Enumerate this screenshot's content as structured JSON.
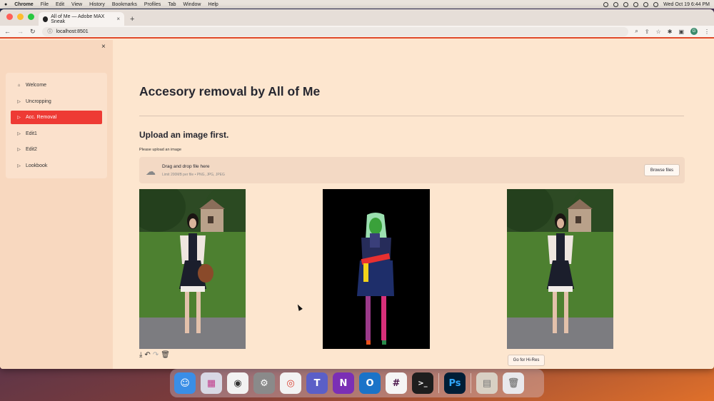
{
  "menubar": {
    "apple": "",
    "app": "Chrome",
    "items": [
      "File",
      "Edit",
      "View",
      "History",
      "Bookmarks",
      "Profiles",
      "Tab",
      "Window",
      "Help"
    ],
    "clock": "Wed Oct 19  6:44 PM"
  },
  "browser": {
    "tab_title": "All of Me — Adobe MAX Sneak",
    "tab_close": "×",
    "new_tab": "+",
    "url": "localhost:8501",
    "profile_initial": "G"
  },
  "sidebar": {
    "close": "×",
    "items": [
      {
        "label": "Welcome",
        "icon": "home-icon",
        "glyph": "⌂"
      },
      {
        "label": "Uncropping",
        "icon": "play-icon",
        "glyph": "▷"
      },
      {
        "label": "Acc. Removal",
        "icon": "play-icon",
        "glyph": "▷"
      },
      {
        "label": "Edit1",
        "icon": "play-icon",
        "glyph": "▷"
      },
      {
        "label": "Edit2",
        "icon": "play-icon",
        "glyph": "▷"
      },
      {
        "label": "Lookbook",
        "icon": "play-icon",
        "glyph": "▷"
      }
    ],
    "active_index": 2
  },
  "main": {
    "title": "Accesory removal by All of Me",
    "subtitle": "Upload an image first.",
    "hint": "Please upload an image",
    "uploader": {
      "title": "Drag and drop file here",
      "limit": "Limit 200MB per file • PNG, JPG, JPEG",
      "button": "Browse files"
    },
    "toolbar": {
      "download": "⤓",
      "undo": "↶",
      "redo": "↷",
      "delete": "🗑"
    },
    "hires_button": "Go for Hi-Res"
  },
  "colors": {
    "accent": "#ee3a34",
    "page_bg": "#fde6cf",
    "sidebar_bg": "#f8d8bf"
  },
  "dock": [
    {
      "name": "finder-icon",
      "glyph": "☺",
      "bg": "#3a8ee6"
    },
    {
      "name": "launchpad-icon",
      "glyph": "▦",
      "bg": "#e0e0e8"
    },
    {
      "name": "screenshot-icon",
      "glyph": "◉",
      "bg": "#f2f2f2"
    },
    {
      "name": "system-settings-icon",
      "glyph": "⚙",
      "bg": "#8a8a8a"
    },
    {
      "name": "chrome-icon",
      "glyph": "◎",
      "bg": "#f2f2f2"
    },
    {
      "name": "teams-icon",
      "glyph": "T",
      "bg": "#5b5fc7"
    },
    {
      "name": "onenote-icon",
      "glyph": "N",
      "bg": "#7b2fb5"
    },
    {
      "name": "outlook-icon",
      "glyph": "O",
      "bg": "#1a73c8"
    },
    {
      "name": "slack-icon",
      "glyph": "#",
      "bg": "#f5f5f5"
    },
    {
      "name": "terminal-icon",
      "glyph": ">_",
      "bg": "#1e1e1e"
    },
    {
      "name": "photoshop-icon",
      "glyph": "Ps",
      "bg": "#001e36"
    },
    {
      "name": "documents-icon",
      "glyph": "▤",
      "bg": "#d8d0c4"
    },
    {
      "name": "trash-icon",
      "glyph": "🗑",
      "bg": "#e8e8ec"
    }
  ]
}
